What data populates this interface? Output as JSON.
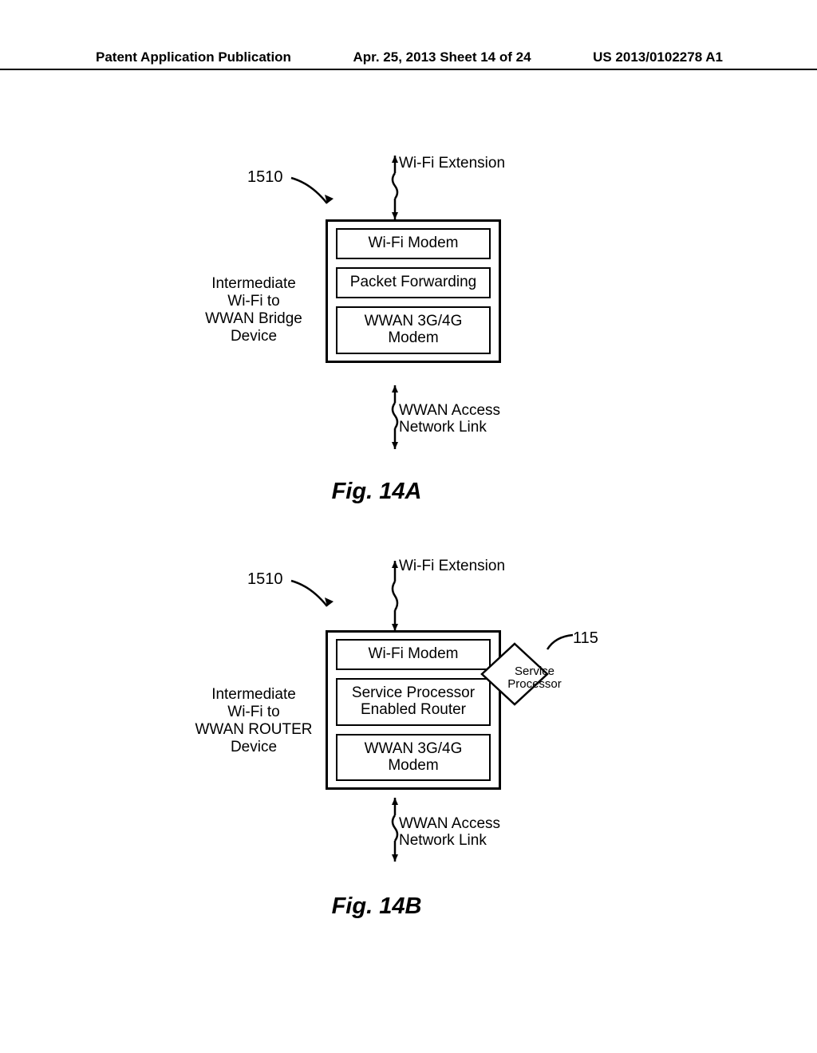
{
  "header": {
    "left": "Patent Application Publication",
    "mid": "Apr. 25, 2013  Sheet 14 of 24",
    "right": "US 2013/0102278 A1"
  },
  "figA": {
    "ref": "1510",
    "topLabel": "Wi-Fi Extension",
    "side": "Intermediate\nWi-Fi to\nWWAN Bridge\nDevice",
    "blocks": [
      "Wi-Fi Modem",
      "Packet Forwarding",
      "WWAN 3G/4G\nModem"
    ],
    "botLabel": "WWAN Access\nNetwork Link",
    "caption": "Fig. 14A"
  },
  "figB": {
    "ref": "1510",
    "topLabel": "Wi-Fi Extension",
    "side": "Intermediate\nWi-Fi to\nWWAN ROUTER\nDevice",
    "blocks": [
      "Wi-Fi Modem",
      "Service Processor\nEnabled Router",
      "WWAN 3G/4G\nModem"
    ],
    "botLabel": "WWAN Access\nNetwork Link",
    "svcLabel": "Service\nProcessor",
    "svcRef": "115",
    "caption": "Fig. 14B"
  }
}
